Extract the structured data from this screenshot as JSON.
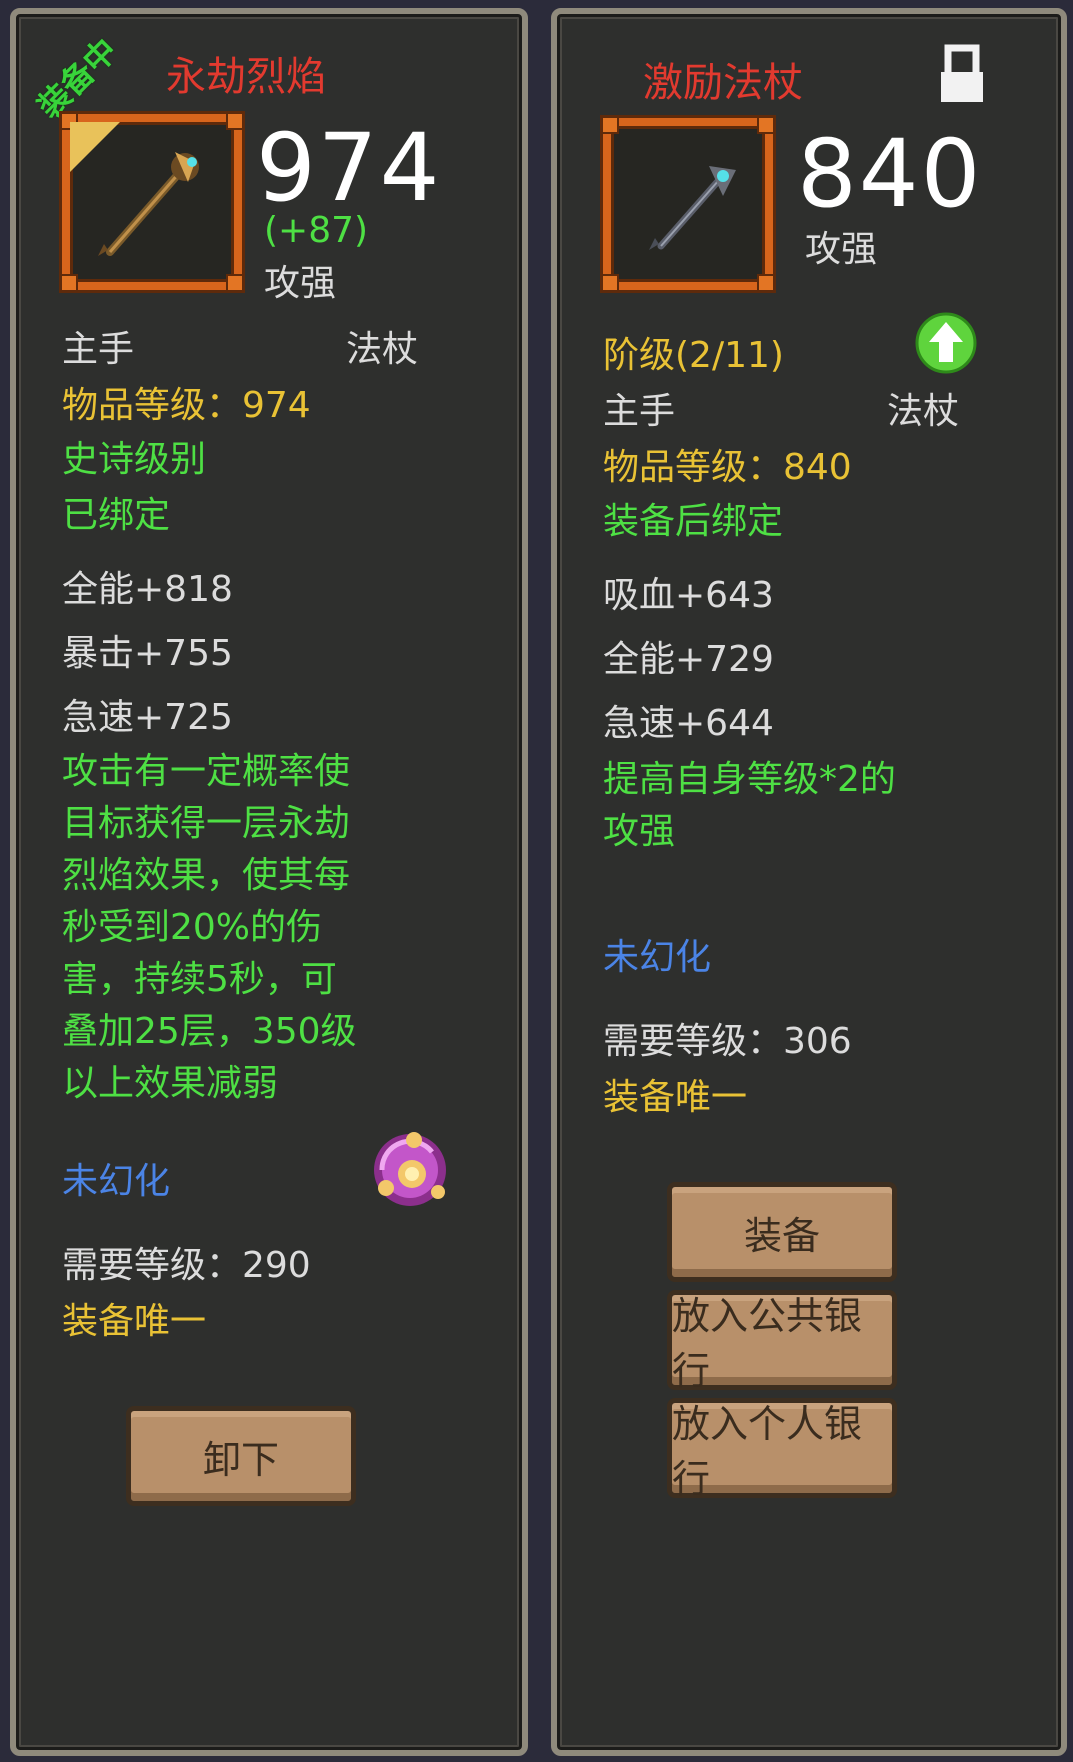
{
  "left": {
    "badge": "装备中",
    "title": "永劫烈焰",
    "stat_value": "974",
    "stat_diff": "(+87)",
    "stat_label": "攻强",
    "slot": "主手",
    "type": "法杖",
    "item_level": "物品等级：974",
    "rarity": "史诗级别",
    "bind": "已绑定",
    "stats": [
      "全能+818",
      "暴击+755",
      "急速+725"
    ],
    "description": "攻击有一定概率使目标获得一层永劫烈焰效果，使其每秒受到20%的伤害，持续5秒，可叠加25层，350级以上效果减弱",
    "transmog": "未幻化",
    "required_level": "需要等级：290",
    "unique": "装备唯一",
    "button": "卸下"
  },
  "right": {
    "title": "激励法杖",
    "stat_value": "840",
    "stat_label": "攻强",
    "tier": "阶级(2/11)",
    "slot": "主手",
    "type": "法杖",
    "item_level": "物品等级：840",
    "bind": "装备后绑定",
    "stats": [
      "吸血+643",
      "全能+729",
      "急速+644"
    ],
    "description": "提高自身等级*2的攻强",
    "transmog": "未幻化",
    "required_level": "需要等级：306",
    "unique": "装备唯一",
    "buttons": [
      "装备",
      "放入公共银行",
      "放入个人银行"
    ]
  },
  "colors": {
    "title": "#e23a2f",
    "yellow": "#e9c235",
    "green": "#4ee044",
    "blue": "#4b84e6",
    "slot_border": "#d8651c",
    "button": "#b8906a"
  }
}
